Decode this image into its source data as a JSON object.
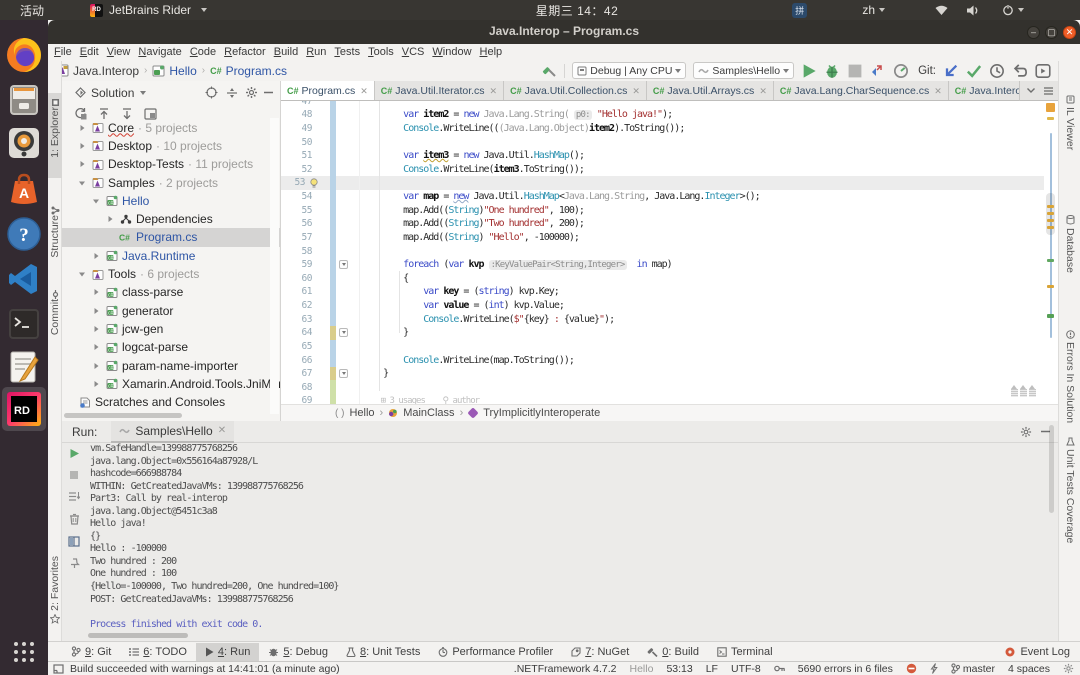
{
  "topbar": {
    "activities": "活动",
    "app_name": "JetBrains Rider",
    "clock": "星期三 14：42",
    "input_method": "拼",
    "language": "zh"
  },
  "dock": {
    "items": [
      "firefox",
      "files",
      "rhythmbox",
      "ubuntu-software",
      "help",
      "vscode",
      "terminal",
      "text-editor",
      "rider",
      "show-applications"
    ]
  },
  "window": {
    "title": "Java.Interop – Program.cs"
  },
  "menu": {
    "items": [
      "File",
      "Edit",
      "View",
      "Navigate",
      "Code",
      "Refactor",
      "Build",
      "Run",
      "Tests",
      "Tools",
      "VCS",
      "Window",
      "Help"
    ]
  },
  "navbar": {
    "crumbs": [
      "Java.Interop",
      "Hello",
      "Program.cs"
    ],
    "build_config": "Debug | Any CPU",
    "run_config": "Samples\\Hello",
    "git_label": "Git:"
  },
  "left_stripe": {
    "tabs": [
      "1: Explorer",
      "Structure",
      "Commit",
      "2: Favorites"
    ]
  },
  "right_stripe": {
    "tabs": [
      "IL Viewer",
      "Database",
      "Errors In Solution",
      "Unit Tests Coverage"
    ]
  },
  "explorer": {
    "title": "Solution",
    "tree": [
      {
        "label": "Core",
        "count": "5 projects",
        "level": 0,
        "chev": "r",
        "icon": "slnfolder",
        "error": true
      },
      {
        "label": "Desktop",
        "count": "10 projects",
        "level": 0,
        "chev": "r",
        "icon": "slnfolder"
      },
      {
        "label": "Desktop-Tests",
        "count": "11 projects",
        "level": 0,
        "chev": "r",
        "icon": "slnfolder"
      },
      {
        "label": "Samples",
        "count": "2 projects",
        "level": 0,
        "chev": "d",
        "icon": "slnfolder"
      },
      {
        "label": "Hello",
        "level": 1,
        "chev": "d",
        "icon": "csproj",
        "blue": true
      },
      {
        "label": "Dependencies",
        "level": 2,
        "chev": "r",
        "icon": "deps"
      },
      {
        "label": "Program.cs",
        "level": 2,
        "icon": "csfile",
        "blue": true,
        "selected": true
      },
      {
        "label": "Java.Runtime",
        "level": 1,
        "chev": "r",
        "icon": "csproj",
        "blue": true
      },
      {
        "label": "Tools",
        "count": "6 projects",
        "level": 0,
        "chev": "d",
        "icon": "slnfolder"
      },
      {
        "label": "class-parse",
        "level": 1,
        "chev": "r",
        "icon": "csproj"
      },
      {
        "label": "generator",
        "level": 1,
        "chev": "r",
        "icon": "csproj"
      },
      {
        "label": "jcw-gen",
        "level": 1,
        "chev": "r",
        "icon": "csproj"
      },
      {
        "label": "logcat-parse",
        "level": 1,
        "chev": "r",
        "icon": "csproj"
      },
      {
        "label": "param-name-importer",
        "level": 1,
        "chev": "r",
        "icon": "csproj"
      },
      {
        "label": "Xamarin.Android.Tools.JniMarsh",
        "level": 1,
        "chev": "r",
        "icon": "csproj"
      },
      {
        "label": "Scratches and Consoles",
        "level": 0,
        "icon": "scratch",
        "noreserve": true
      }
    ]
  },
  "editor": {
    "tabs": [
      {
        "label": "Program.cs",
        "active": true
      },
      {
        "label": "Java.Util.Iterator.cs"
      },
      {
        "label": "Java.Util.Collection.cs"
      },
      {
        "label": "Java.Util.Arrays.cs"
      },
      {
        "label": "Java.Lang.CharSequence.cs"
      },
      {
        "label": "Java.Interop.IJava"
      }
    ],
    "breadcrumbs": [
      "Hello",
      "MainClass",
      "TryImplicitlyInteroperate"
    ],
    "lines": [
      {
        "n": 47,
        "chg": "b",
        "seg": []
      },
      {
        "n": 48,
        "chg": "b",
        "seg": [
          [
            "p",
            "        "
          ],
          [
            "k",
            "var "
          ],
          [
            "d",
            "item2"
          ],
          [
            "p",
            " = "
          ],
          [
            "k",
            "new "
          ],
          [
            "g",
            "Java.Lang.String( "
          ],
          [
            "h",
            "p0:"
          ],
          [
            "p",
            " "
          ],
          [
            "s",
            "\"Hello java!\""
          ],
          [
            "p",
            ");"
          ]
        ]
      },
      {
        "n": 49,
        "chg": "b",
        "seg": [
          [
            "p",
            "        "
          ],
          [
            "t",
            "Console"
          ],
          [
            "p",
            ".WriteLine(("
          ],
          [
            "g",
            "(Java.Lang.Object)"
          ],
          [
            "d",
            "item2"
          ],
          [
            "p",
            ").ToString());"
          ]
        ]
      },
      {
        "n": 50,
        "chg": "b",
        "seg": []
      },
      {
        "n": 51,
        "chg": "b",
        "seg": [
          [
            "p",
            "        "
          ],
          [
            "k",
            "var "
          ],
          [
            "d wy",
            "item3"
          ],
          [
            "p",
            " = "
          ],
          [
            "k",
            "new "
          ],
          [
            "p",
            "Java.Util."
          ],
          [
            "t",
            "HashMap"
          ],
          [
            "p",
            "();"
          ]
        ]
      },
      {
        "n": 52,
        "chg": "b",
        "seg": [
          [
            "p",
            "        "
          ],
          [
            "t",
            "Console"
          ],
          [
            "p",
            ".WriteLine("
          ],
          [
            "d",
            "item3"
          ],
          [
            "p",
            ".ToString());"
          ]
        ]
      },
      {
        "n": 53,
        "chg": "b",
        "seg": [],
        "hl": true,
        "bulb": true
      },
      {
        "n": 54,
        "chg": "b",
        "seg": [
          [
            "p",
            "        "
          ],
          [
            "k",
            "var "
          ],
          [
            "d",
            "map"
          ],
          [
            "p",
            " = "
          ],
          [
            "k wg",
            "new"
          ],
          [
            "p",
            " Java.Util."
          ],
          [
            "t",
            "HashMap"
          ],
          [
            "p",
            "<"
          ],
          [
            "g",
            "Java.Lang.String"
          ],
          [
            "p",
            ", Java.Lang."
          ],
          [
            "t",
            "Integer"
          ],
          [
            "p",
            ">();"
          ]
        ]
      },
      {
        "n": 55,
        "chg": "b",
        "seg": [
          [
            "p",
            "        map.Add(("
          ],
          [
            "t",
            "String"
          ],
          [
            "p",
            ")"
          ],
          [
            "s",
            "\"One hundred\""
          ],
          [
            "p",
            ", 100);"
          ]
        ]
      },
      {
        "n": 56,
        "chg": "b",
        "seg": [
          [
            "p",
            "        map.Add(("
          ],
          [
            "t",
            "String"
          ],
          [
            "p",
            ")"
          ],
          [
            "s",
            "\"Two hundred\""
          ],
          [
            "p",
            ", 200);"
          ]
        ]
      },
      {
        "n": 57,
        "chg": "b",
        "seg": [
          [
            "p",
            "        map.Add(("
          ],
          [
            "t",
            "String"
          ],
          [
            "p",
            ") "
          ],
          [
            "s",
            "\"Hello\""
          ],
          [
            "p",
            ", -100000);"
          ]
        ]
      },
      {
        "n": 58,
        "chg": "b",
        "seg": []
      },
      {
        "n": 59,
        "chg": "b",
        "fold": true,
        "seg": [
          [
            "p",
            "        "
          ],
          [
            "k",
            "foreach"
          ],
          [
            "p",
            " ("
          ],
          [
            "k",
            "var"
          ],
          [
            "p",
            " "
          ],
          [
            "d",
            "kvp"
          ],
          [
            "p",
            " "
          ],
          [
            "h",
            ":KeyValuePair<String,Integer>"
          ],
          [
            "p",
            "  "
          ],
          [
            "k",
            "in"
          ],
          [
            "p",
            " map)"
          ]
        ]
      },
      {
        "n": 60,
        "chg": "b",
        "seg": [
          [
            "p",
            "        {"
          ]
        ]
      },
      {
        "n": 61,
        "chg": "b",
        "seg": [
          [
            "p",
            "            "
          ],
          [
            "k",
            "var "
          ],
          [
            "d",
            "key"
          ],
          [
            "p",
            " = ("
          ],
          [
            "k",
            "string"
          ],
          [
            "p",
            ") kvp.Key;"
          ]
        ]
      },
      {
        "n": 62,
        "chg": "b",
        "seg": [
          [
            "p",
            "            "
          ],
          [
            "k",
            "var "
          ],
          [
            "d",
            "value"
          ],
          [
            "p",
            " = ("
          ],
          [
            "k",
            "int"
          ],
          [
            "p",
            ") kvp.Value;"
          ]
        ]
      },
      {
        "n": 63,
        "chg": "b",
        "seg": [
          [
            "p",
            "            "
          ],
          [
            "t",
            "Console"
          ],
          [
            "p",
            ".WriteLine("
          ],
          [
            "s",
            "$\""
          ],
          [
            "p",
            "{key}"
          ],
          [
            "s",
            " : "
          ],
          [
            "p",
            "{value}"
          ],
          [
            "s",
            "\""
          ],
          [
            "p",
            ");"
          ]
        ]
      },
      {
        "n": 64,
        "chg": "y",
        "fold": true,
        "seg": [
          [
            "p",
            "        }"
          ]
        ]
      },
      {
        "n": 65,
        "chg": "b",
        "seg": []
      },
      {
        "n": 66,
        "chg": "b",
        "seg": [
          [
            "p",
            "        "
          ],
          [
            "t",
            "Console"
          ],
          [
            "p",
            ".WriteLine(map.ToString());"
          ]
        ]
      },
      {
        "n": 67,
        "chg": "y",
        "fold": true,
        "seg": [
          [
            "p",
            "    }"
          ]
        ]
      },
      {
        "n": 68,
        "chg": "g",
        "seg": []
      },
      {
        "n": 69,
        "chg": "g",
        "seg": [
          [
            "gv",
            "    ⊞ 3 usages    ⚲ author"
          ]
        ]
      }
    ]
  },
  "run": {
    "label": "Run:",
    "tab": "Samples\\Hello",
    "console": [
      "vm.SafeHandle=139988775768256",
      "java.lang.Object=0x556164a87928/L",
      "hashcode=666988784",
      "WITHIN: GetCreatedJavaVMs: 139988775768256",
      "Part3: Call by real-interop",
      "java.lang.Object@5451c3a8",
      "Hello java!",
      "{}",
      "Hello : -100000",
      "Two hundred : 200",
      "One hundred : 100",
      "{Hello=-100000, Two hundred=200, One hundred=100}",
      "POST: GetCreatedJavaVMs: 139988775768256",
      ""
    ],
    "exit_line": "Process finished with exit code 0."
  },
  "bottom_bar": {
    "items": [
      {
        "icon": "git-branch",
        "label": "9: Git"
      },
      {
        "icon": "todo-list",
        "label": "6: TODO"
      },
      {
        "icon": "run-play",
        "label": "4: Run",
        "active": true
      },
      {
        "icon": "debug-bug",
        "label": "5: Debug"
      },
      {
        "icon": "unit-tests",
        "label": "8: Unit Tests"
      },
      {
        "icon": "profiler-clock",
        "label": "Performance Profiler"
      },
      {
        "icon": "nuget-package",
        "label": "7: NuGet"
      },
      {
        "icon": "build-hammer",
        "label": "0: Build"
      },
      {
        "icon": "terminal-window",
        "label": "Terminal"
      }
    ],
    "event_log": "Event Log"
  },
  "status_bar": {
    "message": "Build succeeded with warnings at 14:41:01 (a minute ago)",
    "framework": ".NETFramework 4.7.2",
    "project": "Hello",
    "caret": "53:13",
    "line_ending": "LF",
    "encoding": "UTF-8",
    "errors": "5690 errors in 6 files",
    "branch": "master",
    "indent": "4 spaces"
  }
}
